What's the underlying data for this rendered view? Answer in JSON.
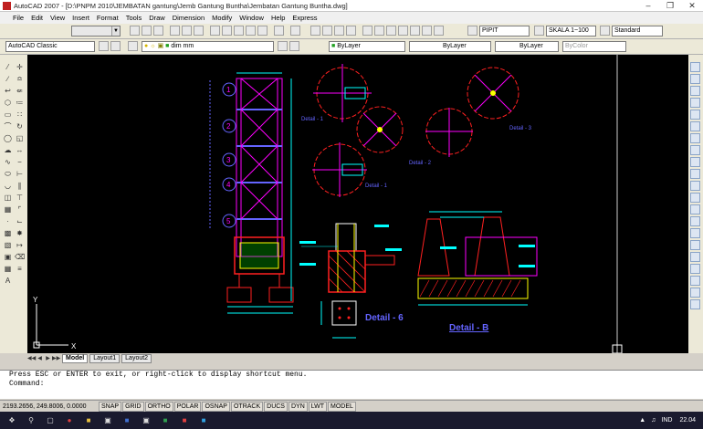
{
  "window": {
    "title": "AutoCAD 2007 - [D:\\PNPM 2010\\JEMBATAN gantung\\Jemb Gantung Buntha\\Jembatan Gantung Buntha.dwg]"
  },
  "menu": [
    "File",
    "Edit",
    "View",
    "Insert",
    "Format",
    "Tools",
    "Draw",
    "Dimension",
    "Modify",
    "Window",
    "Help",
    "Express"
  ],
  "toolbar": {
    "text_style": "PIPIT",
    "dim_style": "SKALA 1~100",
    "table_style": "Standard",
    "workspace": "AutoCAD Classic",
    "layer": "dim mm",
    "color": "ByLayer",
    "linetype": "ByLayer",
    "lineweight": "ByLayer",
    "plotstyle": "ByColor"
  },
  "drawing": {
    "grid_numbers": [
      "1",
      "2",
      "3",
      "4",
      "5"
    ],
    "labels": {
      "detail1a": "Detail - 1",
      "detail1b": "Detail - 1",
      "detail2": "Detail - 2",
      "detail3": "Detail - 3",
      "detail6": "Detail - 6",
      "detailB": "Detail - B"
    }
  },
  "tabs": [
    "Model",
    "Layout1",
    "Layout2"
  ],
  "command": {
    "line1": "Press ESC or ENTER to exit, or right-click to display shortcut menu.",
    "line2": "Command:"
  },
  "status": {
    "coords": "2193.2656, 249.8006, 0.0000",
    "buttons": [
      "SNAP",
      "GRID",
      "ORTHO",
      "POLAR",
      "OSNAP",
      "OTRACK",
      "DUCS",
      "DYN",
      "LWT",
      "MODEL"
    ]
  },
  "taskbar": {
    "lang": "IND",
    "time": "22.04"
  },
  "colors": {
    "canvas": "#000000",
    "magenta": "#ff00ff",
    "red": "#ff2020",
    "cyan": "#00ffff",
    "blue": "#6464ff",
    "white": "#ffffff",
    "yellow": "#ffff00",
    "green": "#00ff00"
  }
}
